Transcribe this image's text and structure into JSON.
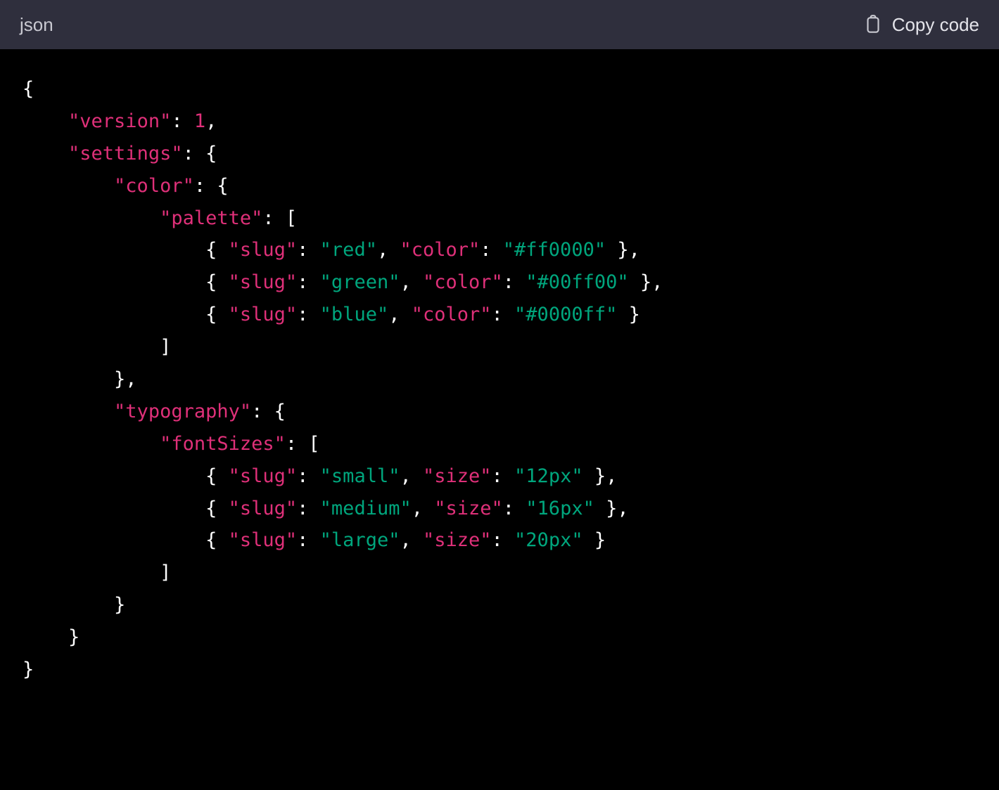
{
  "header": {
    "language_label": "json",
    "copy_label": "Copy code"
  },
  "code": {
    "lines": [
      [
        {
          "t": "punc",
          "v": "{"
        }
      ],
      [
        {
          "t": "indent",
          "v": 4
        },
        {
          "t": "key",
          "v": "\"version\""
        },
        {
          "t": "punc",
          "v": ": "
        },
        {
          "t": "num",
          "v": "1"
        },
        {
          "t": "punc",
          "v": ","
        }
      ],
      [
        {
          "t": "indent",
          "v": 4
        },
        {
          "t": "key",
          "v": "\"settings\""
        },
        {
          "t": "punc",
          "v": ": {"
        }
      ],
      [
        {
          "t": "indent",
          "v": 8
        },
        {
          "t": "key",
          "v": "\"color\""
        },
        {
          "t": "punc",
          "v": ": {"
        }
      ],
      [
        {
          "t": "indent",
          "v": 12
        },
        {
          "t": "key",
          "v": "\"palette\""
        },
        {
          "t": "punc",
          "v": ": ["
        }
      ],
      [
        {
          "t": "indent",
          "v": 16
        },
        {
          "t": "punc",
          "v": "{ "
        },
        {
          "t": "key",
          "v": "\"slug\""
        },
        {
          "t": "punc",
          "v": ": "
        },
        {
          "t": "str",
          "v": "\"red\""
        },
        {
          "t": "punc",
          "v": ", "
        },
        {
          "t": "key",
          "v": "\"color\""
        },
        {
          "t": "punc",
          "v": ": "
        },
        {
          "t": "str",
          "v": "\"#ff0000\""
        },
        {
          "t": "punc",
          "v": " },"
        }
      ],
      [
        {
          "t": "indent",
          "v": 16
        },
        {
          "t": "punc",
          "v": "{ "
        },
        {
          "t": "key",
          "v": "\"slug\""
        },
        {
          "t": "punc",
          "v": ": "
        },
        {
          "t": "str",
          "v": "\"green\""
        },
        {
          "t": "punc",
          "v": ", "
        },
        {
          "t": "key",
          "v": "\"color\""
        },
        {
          "t": "punc",
          "v": ": "
        },
        {
          "t": "str",
          "v": "\"#00ff00\""
        },
        {
          "t": "punc",
          "v": " },"
        }
      ],
      [
        {
          "t": "indent",
          "v": 16
        },
        {
          "t": "punc",
          "v": "{ "
        },
        {
          "t": "key",
          "v": "\"slug\""
        },
        {
          "t": "punc",
          "v": ": "
        },
        {
          "t": "str",
          "v": "\"blue\""
        },
        {
          "t": "punc",
          "v": ", "
        },
        {
          "t": "key",
          "v": "\"color\""
        },
        {
          "t": "punc",
          "v": ": "
        },
        {
          "t": "str",
          "v": "\"#0000ff\""
        },
        {
          "t": "punc",
          "v": " }"
        }
      ],
      [
        {
          "t": "indent",
          "v": 12
        },
        {
          "t": "punc",
          "v": "]"
        }
      ],
      [
        {
          "t": "indent",
          "v": 8
        },
        {
          "t": "punc",
          "v": "},"
        }
      ],
      [
        {
          "t": "indent",
          "v": 8
        },
        {
          "t": "key",
          "v": "\"typography\""
        },
        {
          "t": "punc",
          "v": ": {"
        }
      ],
      [
        {
          "t": "indent",
          "v": 12
        },
        {
          "t": "key",
          "v": "\"fontSizes\""
        },
        {
          "t": "punc",
          "v": ": ["
        }
      ],
      [
        {
          "t": "indent",
          "v": 16
        },
        {
          "t": "punc",
          "v": "{ "
        },
        {
          "t": "key",
          "v": "\"slug\""
        },
        {
          "t": "punc",
          "v": ": "
        },
        {
          "t": "str",
          "v": "\"small\""
        },
        {
          "t": "punc",
          "v": ", "
        },
        {
          "t": "key",
          "v": "\"size\""
        },
        {
          "t": "punc",
          "v": ": "
        },
        {
          "t": "str",
          "v": "\"12px\""
        },
        {
          "t": "punc",
          "v": " },"
        }
      ],
      [
        {
          "t": "indent",
          "v": 16
        },
        {
          "t": "punc",
          "v": "{ "
        },
        {
          "t": "key",
          "v": "\"slug\""
        },
        {
          "t": "punc",
          "v": ": "
        },
        {
          "t": "str",
          "v": "\"medium\""
        },
        {
          "t": "punc",
          "v": ", "
        },
        {
          "t": "key",
          "v": "\"size\""
        },
        {
          "t": "punc",
          "v": ": "
        },
        {
          "t": "str",
          "v": "\"16px\""
        },
        {
          "t": "punc",
          "v": " },"
        }
      ],
      [
        {
          "t": "indent",
          "v": 16
        },
        {
          "t": "punc",
          "v": "{ "
        },
        {
          "t": "key",
          "v": "\"slug\""
        },
        {
          "t": "punc",
          "v": ": "
        },
        {
          "t": "str",
          "v": "\"large\""
        },
        {
          "t": "punc",
          "v": ", "
        },
        {
          "t": "key",
          "v": "\"size\""
        },
        {
          "t": "punc",
          "v": ": "
        },
        {
          "t": "str",
          "v": "\"20px\""
        },
        {
          "t": "punc",
          "v": " }"
        }
      ],
      [
        {
          "t": "indent",
          "v": 12
        },
        {
          "t": "punc",
          "v": "]"
        }
      ],
      [
        {
          "t": "indent",
          "v": 8
        },
        {
          "t": "punc",
          "v": "}"
        }
      ],
      [
        {
          "t": "indent",
          "v": 4
        },
        {
          "t": "punc",
          "v": "}"
        }
      ],
      [
        {
          "t": "punc",
          "v": "}"
        }
      ]
    ]
  }
}
